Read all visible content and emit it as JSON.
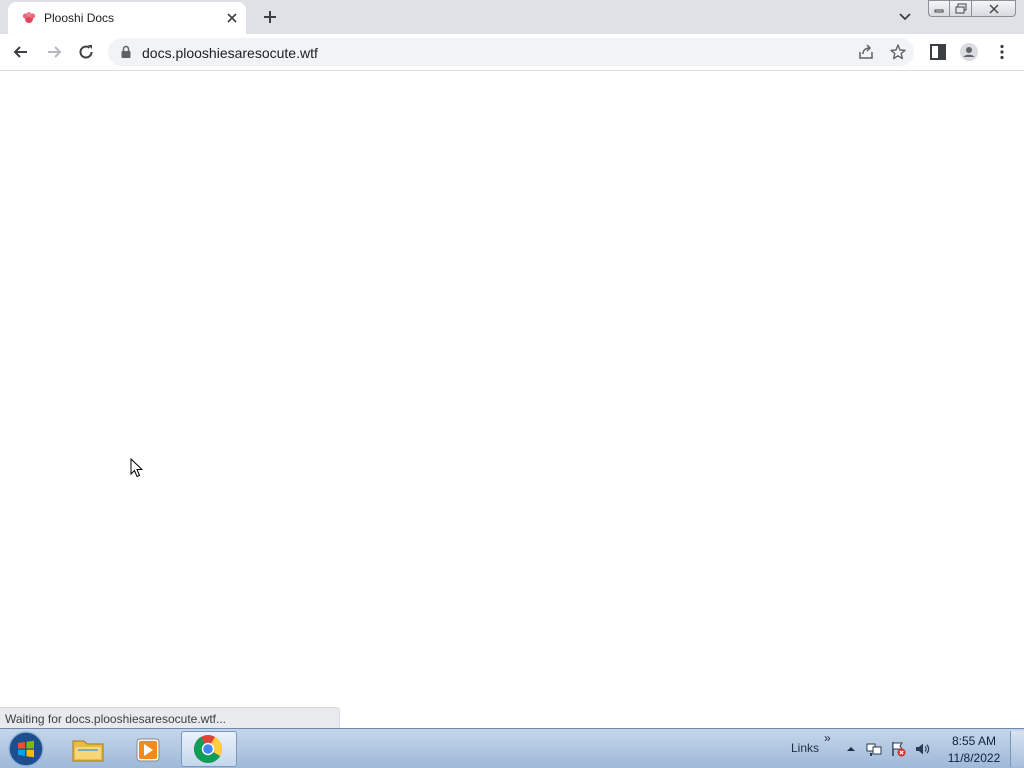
{
  "browser": {
    "tab": {
      "title": "Plooshi Docs",
      "favicon": "flower-favicon"
    },
    "new_tab_icon": "plus-icon",
    "tab_search_icon": "chevron-down-icon",
    "address": {
      "url": "docs.plooshiesaresocute.wtf",
      "secure_icon": "lock-icon"
    },
    "nav_icons": [
      "back-arrow-icon",
      "forward-arrow-icon",
      "reload-icon"
    ],
    "omnibox_actions": [
      "share-icon",
      "star-icon"
    ],
    "toolbar_actions": [
      "side-panel-icon",
      "profile-icon",
      "menu-dots-icon"
    ],
    "window_controls": [
      "minimize-icon",
      "restore-icon",
      "close-icon"
    ]
  },
  "status": {
    "text": "Waiting for docs.plooshiesaresocute.wtf..."
  },
  "taskbar": {
    "items": [
      "start-orb-icon",
      "file-explorer-icon",
      "media-player-icon",
      "chrome-icon"
    ],
    "links_label": "Links",
    "links_chevron": "»",
    "tray_icons": [
      "tray-expand-icon",
      "network-icon",
      "action-center-icon",
      "volume-icon"
    ],
    "clock": {
      "time": "8:55 AM",
      "date": "11/8/2022"
    }
  },
  "colors": {
    "tabstrip": "#dee1e6",
    "omnibox": "#f1f3f4",
    "favicon": "#e0465a",
    "taskbar": "#b3c8e2"
  }
}
